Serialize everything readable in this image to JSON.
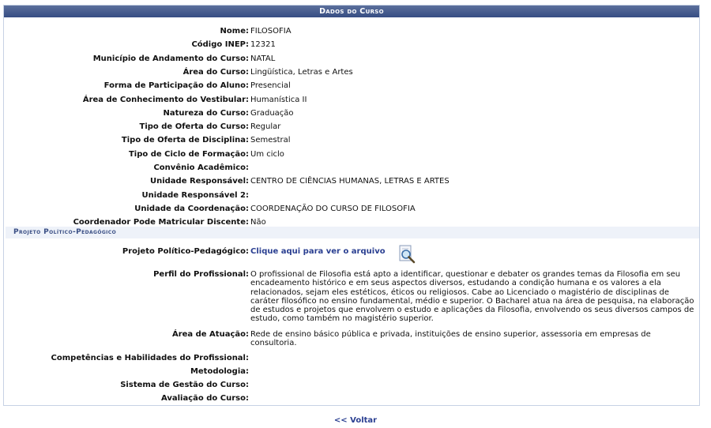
{
  "panel": {
    "title": "Dados do Curso"
  },
  "fields": [
    {
      "label": "Nome:",
      "value": "FILOSOFIA"
    },
    {
      "label": "Código INEP:",
      "value": "12321"
    },
    {
      "label": "Município de Andamento do Curso:",
      "value": "NATAL"
    },
    {
      "label": "Área do Curso:",
      "value": "Lingüística, Letras e Artes"
    },
    {
      "label": "Forma de Participação do Aluno:",
      "value": "Presencial"
    },
    {
      "label": "Área de Conhecimento do Vestibular:",
      "value": "Humanística II"
    },
    {
      "label": "Natureza do Curso:",
      "value": "Graduação"
    },
    {
      "label": "Tipo de Oferta do Curso:",
      "value": "Regular"
    },
    {
      "label": "Tipo de Oferta de Disciplina:",
      "value": "Semestral"
    },
    {
      "label": "Tipo de Ciclo de Formação:",
      "value": "Um ciclo"
    },
    {
      "label": "Convênio Acadêmico:",
      "value": ""
    },
    {
      "label": "Unidade Responsável:",
      "value": "CENTRO DE CIÊNCIAS HUMANAS, LETRAS E ARTES"
    },
    {
      "label": "Unidade Responsável 2:",
      "value": ""
    },
    {
      "label": "Unidade da Coordenação:",
      "value": "COORDENAÇÃO DO CURSO DE FILOSOFIA"
    },
    {
      "label": "Coordenador Pode Matricular Discente:",
      "value": "Não"
    }
  ],
  "ppp": {
    "section_title": "Projeto Político-Pedagógico",
    "ppp_label": "Projeto Político-Pedagógico:",
    "ppp_link": "Clique aqui para ver o arquivo",
    "perfil_label": "Perfil do Profissional:",
    "perfil_value": "O profissional de Filosofia está apto a identificar, questionar e debater os grandes temas da Filosofia em seu encadeamento histórico e em seus aspectos diversos, estudando a condição humana e os valores a ela relacionados, sejam eles estéticos, éticos ou religiosos. Cabe ao Licenciado o magistério de disciplinas de caráter filosófico no ensino fundamental, médio e superior. O Bacharel atua na área de pesquisa, na elaboração de estudos e projetos que envolvem o estudo e aplicações da Filosofia, envolvendo os seus diversos campos de estudo, como também no magistério superior.",
    "atuacao_label": "Área de Atuação:",
    "atuacao_value": "Rede de ensino básico pública e privada, instituições de ensino superior, assessoria em empresas de consultoria.",
    "competencias_label": "Competências e Habilidades do Profissional:",
    "metodologia_label": "Metodologia:",
    "gestao_label": "Sistema de Gestão do Curso:",
    "avaliacao_label": "Avaliação do Curso:"
  },
  "footer": {
    "back_label": "<< Voltar"
  },
  "icons": {
    "view_file": "magnifier-document-icon"
  }
}
